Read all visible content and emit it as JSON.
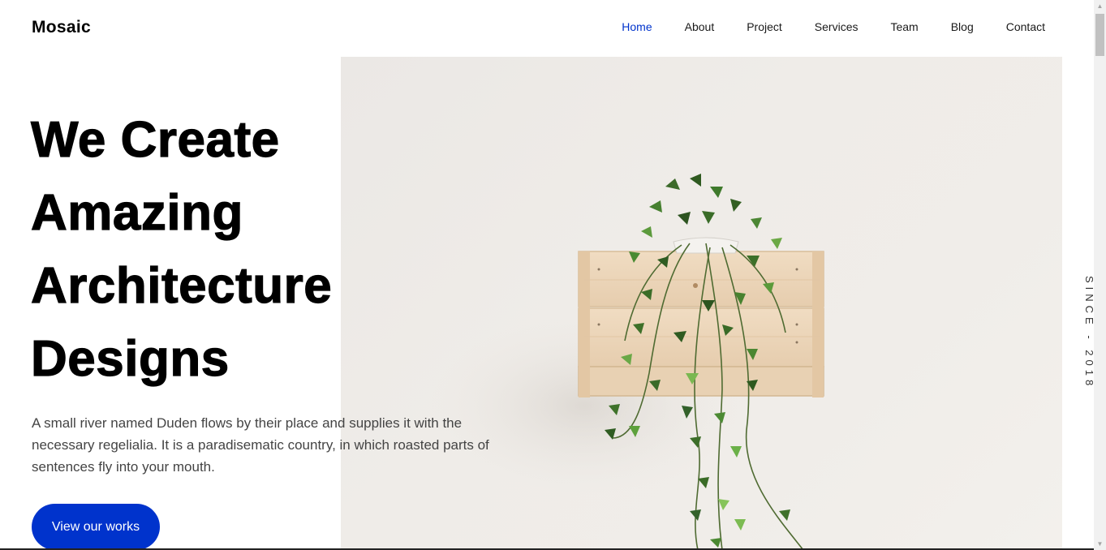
{
  "header": {
    "brand": "Mosaic",
    "nav": [
      {
        "label": "Home",
        "active": true
      },
      {
        "label": "About",
        "active": false
      },
      {
        "label": "Project",
        "active": false
      },
      {
        "label": "Services",
        "active": false
      },
      {
        "label": "Team",
        "active": false
      },
      {
        "label": "Blog",
        "active": false
      },
      {
        "label": "Contact",
        "active": false
      }
    ]
  },
  "hero": {
    "title_lines": [
      "We Create",
      "Amazing",
      "Architecture",
      "Designs"
    ],
    "description": "A small river named Duden flows by their place and supplies it with the necessary regelialia. It is a paradisematic country, in which roasted parts of sentences fly into your mouth.",
    "cta_label": "View our works",
    "since": "SINCE - 2018"
  },
  "icons": {
    "scroll_up": "triangle-up",
    "scroll_down": "triangle-down"
  },
  "colors": {
    "accent": "#0033cc",
    "text": "#000000",
    "body_text": "#444444"
  }
}
